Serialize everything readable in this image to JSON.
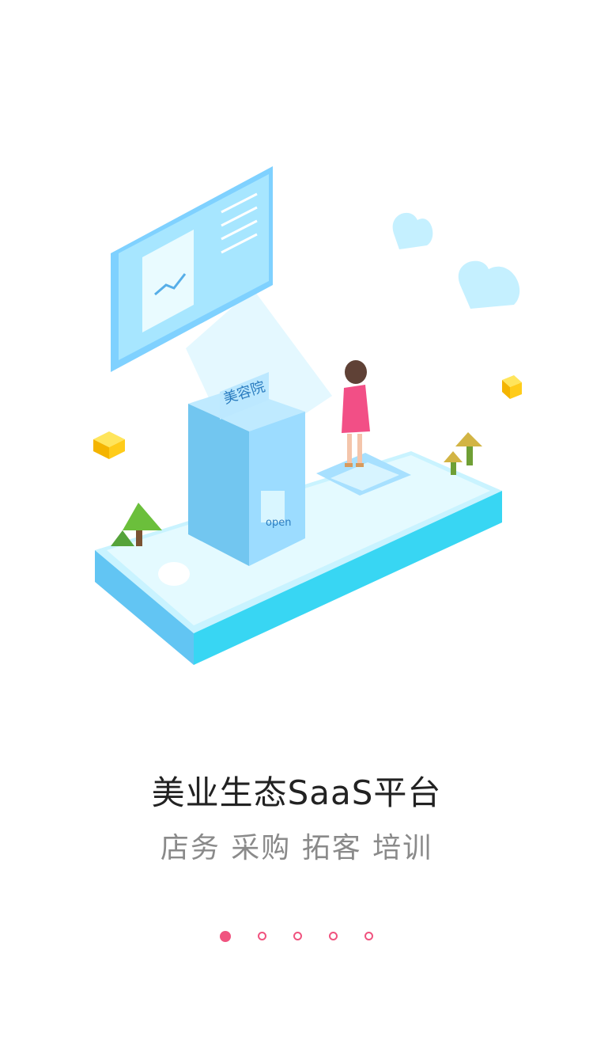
{
  "onboarding": {
    "title": "美业生态SaaS平台",
    "subtitle": "店务 采购 拓客 培训",
    "illustration": {
      "sign_text": "美容院",
      "door_sign_text": "open"
    },
    "pagination": {
      "total": 5,
      "current": 1,
      "active_color": "#f0537f"
    }
  }
}
